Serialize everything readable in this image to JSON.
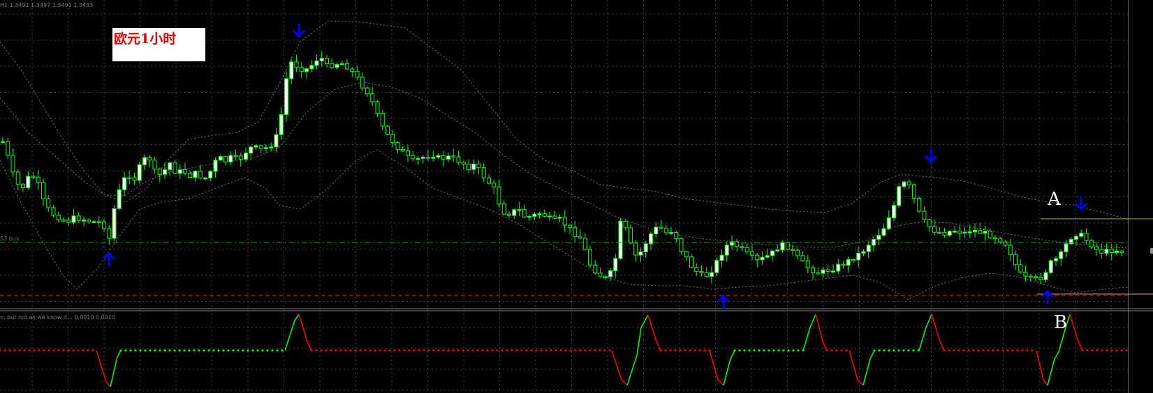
{
  "header_text": "H1 1.3491 1.3497 1.3491 1.3493",
  "annotation_text": "欧元1小时",
  "marker_A": "A",
  "marker_B": "B",
  "buy_label": "53 buy",
  "indicator_header": "n, but not as we know it... 0.0010 0.0010",
  "colors": {
    "background": "#000000",
    "grid": "#2f4f4f",
    "bull_candle": "#ffffff",
    "bear_candle": "#00ff00",
    "wick": "#00ff00",
    "bands": "#777777",
    "signal_arrow": "#0000ff",
    "buy_line": "#00aa00",
    "support_line": "#ff2020",
    "level_line_A": "#b5b000",
    "level_line_B": "#d8a050",
    "indicator_up": "#00ff00",
    "indicator_down": "#ff0000"
  },
  "chart_data": {
    "type": "candlestick",
    "timeframe": "H1",
    "signals": [
      {
        "bar": 20,
        "direction": "up"
      },
      {
        "bar": 55,
        "direction": "down"
      },
      {
        "bar": 136,
        "direction": "up"
      },
      {
        "bar": 178,
        "direction": "down"
      },
      {
        "bar": 198,
        "direction": "up"
      },
      {
        "bar": 202,
        "direction": "down"
      }
    ],
    "indicator": {
      "type": "line",
      "baseline_description": "flat zero line with spikes",
      "spike_bars": [
        20,
        55,
        118,
        136,
        152,
        166,
        178,
        198,
        202
      ]
    }
  }
}
